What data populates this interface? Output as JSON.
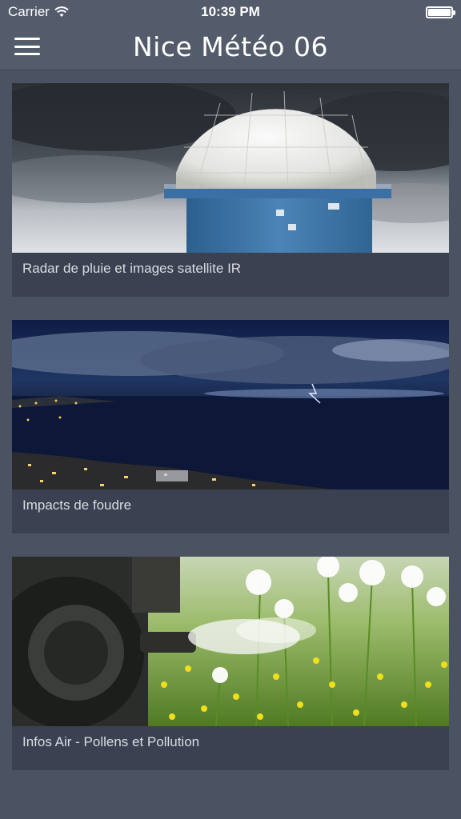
{
  "status_bar": {
    "carrier": "Carrier",
    "time": "10:39 PM"
  },
  "nav": {
    "title": "Nice Météo 06"
  },
  "cards": [
    {
      "label": "Radar de pluie et images satellite IR"
    },
    {
      "label": "Impacts de foudre"
    },
    {
      "label": "Infos Air - Pollens et Pollution"
    }
  ]
}
